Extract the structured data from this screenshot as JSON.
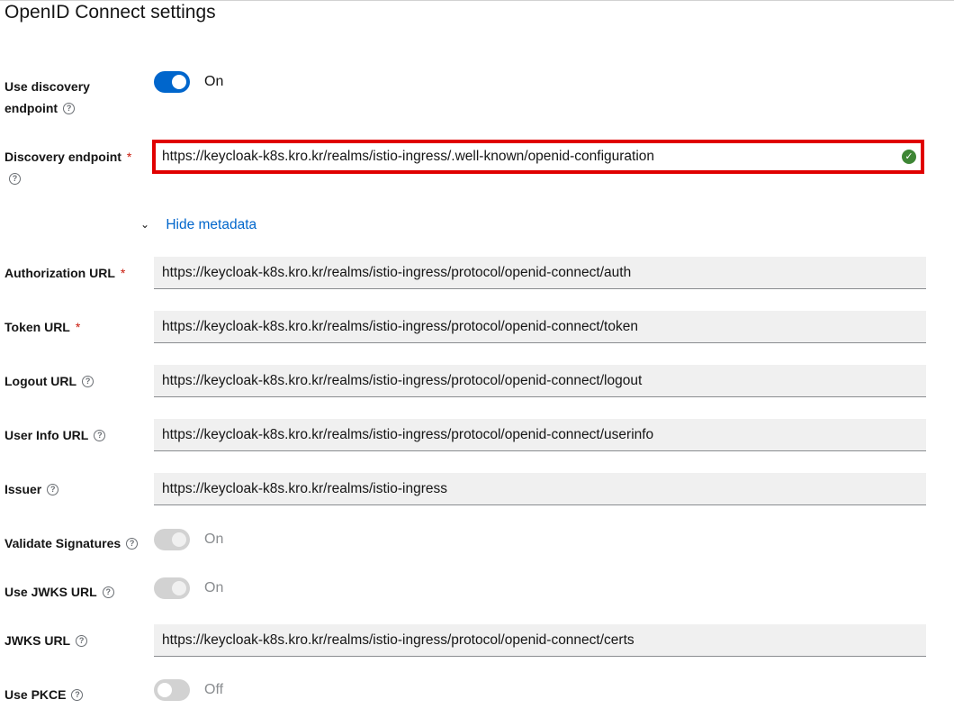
{
  "section_title": "OpenID Connect settings",
  "use_discovery": {
    "label_line1": "Use discovery",
    "label_line2": "endpoint",
    "state": "On"
  },
  "discovery_endpoint": {
    "label": "Discovery endpoint",
    "required": "*",
    "value": "https://keycloak-k8s.kro.kr/realms/istio-ingress/.well-known/openid-configuration"
  },
  "metadata_toggle": {
    "label": "Hide metadata"
  },
  "authorization_url": {
    "label": "Authorization URL",
    "required": "*",
    "value": "https://keycloak-k8s.kro.kr/realms/istio-ingress/protocol/openid-connect/auth"
  },
  "token_url": {
    "label": "Token URL",
    "required": "*",
    "value": "https://keycloak-k8s.kro.kr/realms/istio-ingress/protocol/openid-connect/token"
  },
  "logout_url": {
    "label": "Logout URL",
    "value": "https://keycloak-k8s.kro.kr/realms/istio-ingress/protocol/openid-connect/logout"
  },
  "user_info_url": {
    "label": "User Info URL",
    "value": "https://keycloak-k8s.kro.kr/realms/istio-ingress/protocol/openid-connect/userinfo"
  },
  "issuer": {
    "label": "Issuer",
    "value": "https://keycloak-k8s.kro.kr/realms/istio-ingress"
  },
  "validate_signatures": {
    "label": "Validate Signatures",
    "state": "On"
  },
  "use_jwks_url": {
    "label": "Use JWKS URL",
    "state": "On"
  },
  "jwks_url": {
    "label": "JWKS URL",
    "value": "https://keycloak-k8s.kro.kr/realms/istio-ingress/protocol/openid-connect/certs"
  },
  "use_pkce": {
    "label": "Use PKCE",
    "state": "Off"
  },
  "help_glyph": "?",
  "valid_glyph": "✓",
  "chevron_glyph": "⌄"
}
